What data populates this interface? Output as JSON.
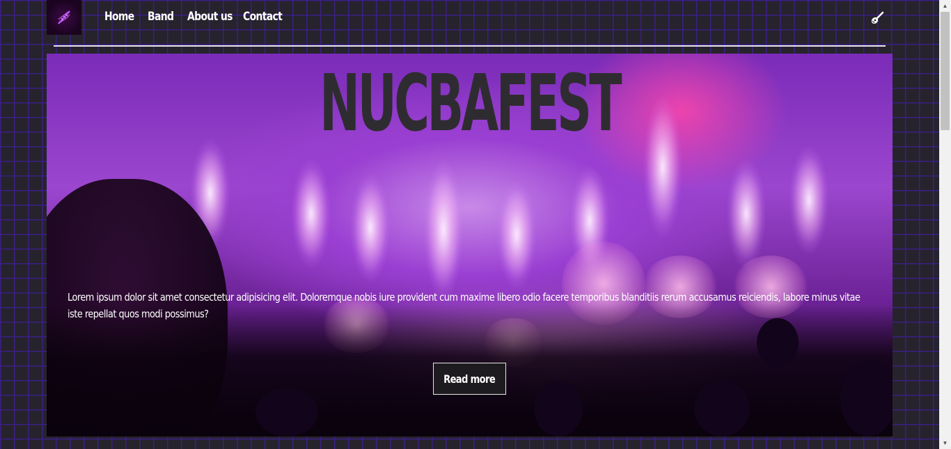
{
  "nav": {
    "links": [
      "Home",
      "Band",
      "About us",
      "Contact"
    ]
  },
  "hero": {
    "title": "NUCBAFEST",
    "text": "Lorem ipsum dolor sit amet consectetur adipisicing elit. Doloremque nobis iure provident cum maxime libero odio facere temporibus blanditiis rerum accusamus reiciendis, labore minus vitae iste repellat quos modi possimus?",
    "button_label": "Read more"
  },
  "icons": {
    "logo": "dna-icon",
    "guitar": "guitar-icon"
  },
  "colors": {
    "background": "#26232c",
    "brick_lines": "#3a1f86",
    "hero_purple": "#9b46cf",
    "title": "#2f2c31"
  }
}
